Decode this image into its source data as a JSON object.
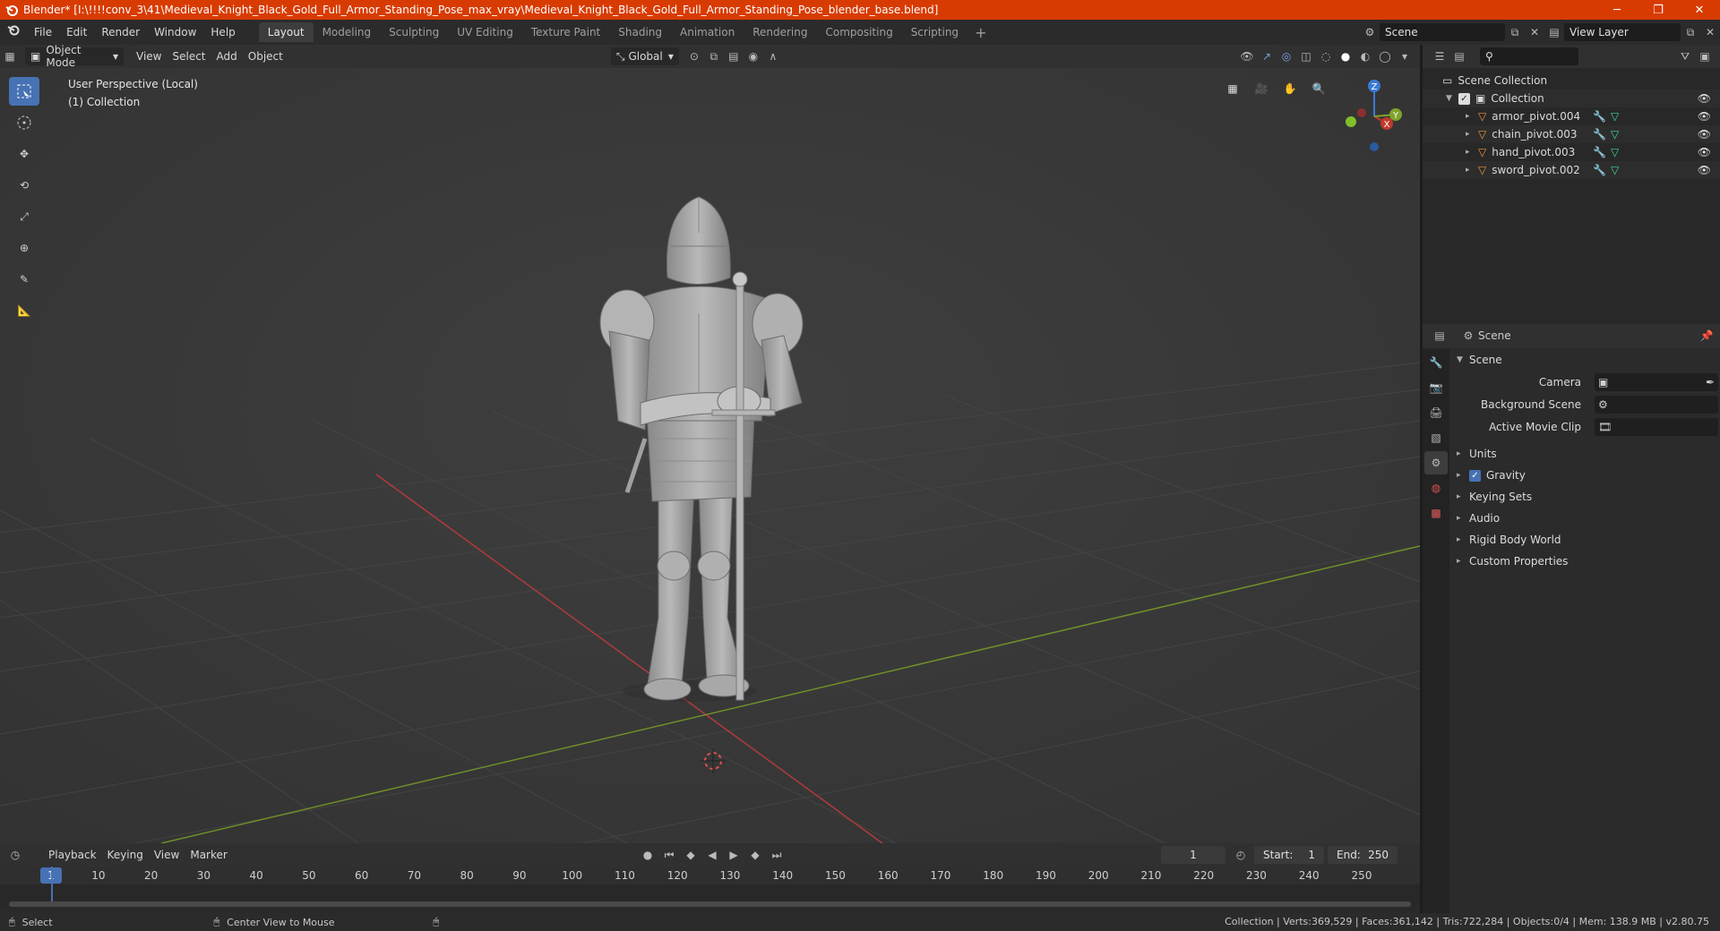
{
  "window": {
    "title": "Blender* [I:\\!!!!conv_3\\41\\Medieval_Knight_Black_Gold_Full_Armor_Standing_Pose_max_vray\\Medieval_Knight_Black_Gold_Full_Armor_Standing_Pose_blender_base.blend]",
    "minimize": "─",
    "maximize": "❐",
    "close": "✕"
  },
  "menu": [
    "File",
    "Edit",
    "Render",
    "Window",
    "Help"
  ],
  "workspaces": [
    "Layout",
    "Modeling",
    "Sculpting",
    "UV Editing",
    "Texture Paint",
    "Shading",
    "Animation",
    "Rendering",
    "Compositing",
    "Scripting"
  ],
  "active_workspace": "Layout",
  "top_right": {
    "scene": "Scene",
    "view_layer": "View Layer"
  },
  "viewport": {
    "mode": "Object Mode",
    "menus": [
      "View",
      "Select",
      "Add",
      "Object"
    ],
    "orientation": "Global",
    "info_line1": "User Perspective (Local)",
    "info_line2": "(1) Collection",
    "gizmo": {
      "x": "X",
      "y": "Y",
      "z": "Z"
    }
  },
  "tools": [
    "select-box",
    "cursor",
    "move",
    "rotate",
    "scale",
    "transform",
    "annotate",
    "measure"
  ],
  "timeline": {
    "menus": [
      "Playback",
      "Keying",
      "View",
      "Marker"
    ],
    "current_frame": "1",
    "start_label": "Start:",
    "start": "1",
    "end_label": "End:",
    "end": "250",
    "ruler": [
      "1",
      "10",
      "20",
      "30",
      "40",
      "50",
      "60",
      "70",
      "80",
      "90",
      "100",
      "110",
      "120",
      "130",
      "140",
      "150",
      "160",
      "170",
      "180",
      "190",
      "200",
      "210",
      "220",
      "230",
      "240",
      "250"
    ]
  },
  "outliner": {
    "scene_collection": "Scene Collection",
    "collection": "Collection",
    "objects": [
      "armor_pivot.004",
      "chain_pivot.003",
      "hand_pivot.003",
      "sword_pivot.002"
    ]
  },
  "properties": {
    "header": "Scene",
    "panel": "Scene",
    "camera_label": "Camera",
    "background_scene_label": "Background Scene",
    "active_movie_clip_label": "Active Movie Clip",
    "subpanels": [
      "Units",
      "Gravity",
      "Keying Sets",
      "Audio",
      "Rigid Body World",
      "Custom Properties"
    ]
  },
  "status": {
    "select": "Select",
    "center_view": "Center View to Mouse",
    "stats": "Collection | Verts:369,529 | Faces:361,142 | Tris:722,284 | Objects:0/4 | Mem: 138.9 MB | v2.80.75"
  },
  "colors": {
    "titlebar": "#d83b01",
    "accent": "#4772b3",
    "x_axis": "#c0392b",
    "y_axis": "#7fa32a",
    "z_axis": "#3a7bd5"
  }
}
